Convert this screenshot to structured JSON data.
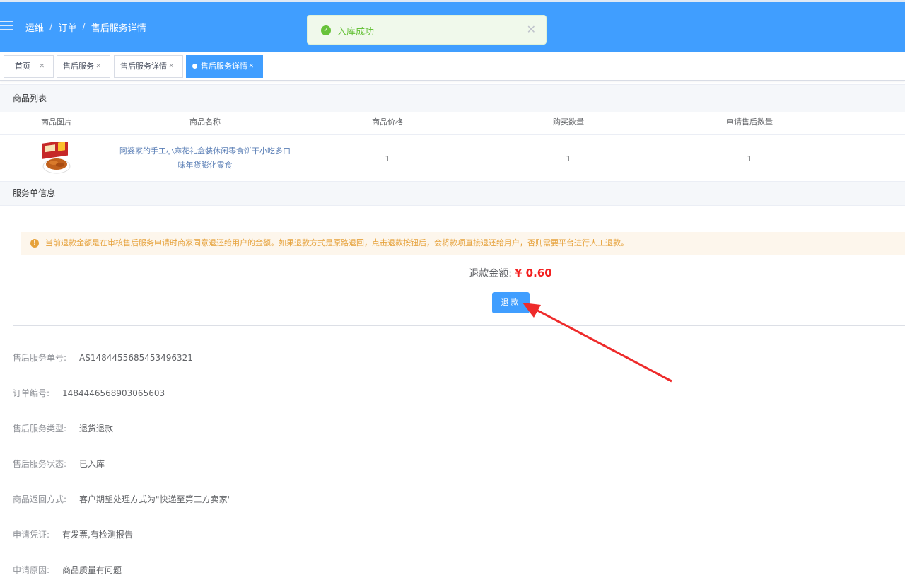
{
  "header": {
    "breadcrumb": [
      "运维",
      "订单",
      "售后服务详情"
    ],
    "separator": "/"
  },
  "toast": {
    "message": "入库成功",
    "type": "success"
  },
  "tags": [
    {
      "label": "首页",
      "active": false
    },
    {
      "label": "售后服务",
      "active": false
    },
    {
      "label": "售后服务详情",
      "active": false
    },
    {
      "label": "售后服务详情",
      "active": true
    }
  ],
  "product_section": {
    "title": "商品列表",
    "columns": [
      "商品图片",
      "商品名称",
      "商品价格",
      "购买数量",
      "申请售后数量"
    ],
    "rows": [
      {
        "name": "阿婆家的手工小麻花礼盒装休闲零食饼干小吃多口味年货膨化零食",
        "price": "1",
        "quantity": "1",
        "after_sale_quantity": "1"
      }
    ]
  },
  "service_section": {
    "title": "服务单信息",
    "alert": "当前退款金额是在审核售后服务申请时商家同意退还给用户的金额。如果退款方式是原路退回，点击退款按钮后，会将款项直接退还给用户，否则需要平台进行人工退款。",
    "refund_label": "退款金额:",
    "refund_amount": "¥ 0.60",
    "refund_button": "退款"
  },
  "details": [
    {
      "label": "售后服务单号:",
      "value": "AS1484455685453496321"
    },
    {
      "label": "订单编号:",
      "value": "1484446568903065603"
    },
    {
      "label": "售后服务类型:",
      "value": "退货退款"
    },
    {
      "label": "售后服务状态:",
      "value": "已入库"
    },
    {
      "label": "商品返回方式:",
      "value": "客户期望处理方式为\"快递至第三方卖家\""
    },
    {
      "label": "申请凭证:",
      "value": "有发票,有检测报告"
    },
    {
      "label": "申请原因:",
      "value": "商品质量有问题"
    }
  ],
  "colors": {
    "primary": "#409eff",
    "success": "#67c23a",
    "warning": "#e6a23c",
    "danger": "#f31f1f"
  }
}
